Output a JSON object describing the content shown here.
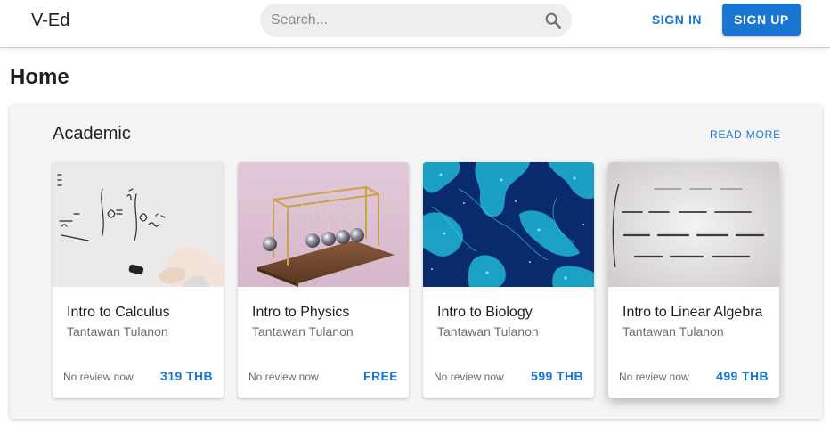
{
  "header": {
    "brand": "V-Ed",
    "search_placeholder": "Search...",
    "signin_label": "SIGN IN",
    "signup_label": "SIGN UP",
    "accent_color": "#1976d2"
  },
  "page": {
    "title": "Home"
  },
  "section": {
    "title": "Academic",
    "read_more": "READ MORE",
    "courses": [
      {
        "title": "Intro to Calculus",
        "author": "Tantawan Tulanon",
        "review": "No review now",
        "price": "319 THB"
      },
      {
        "title": "Intro to Physics",
        "author": "Tantawan Tulanon",
        "review": "No review now",
        "price": "FREE"
      },
      {
        "title": "Intro to Biology",
        "author": "Tantawan Tulanon",
        "review": "No review now",
        "price": "599 THB"
      },
      {
        "title": "Intro to Linear Algebra",
        "author": "Tantawan Tulanon",
        "review": "No review now",
        "price": "499 THB"
      }
    ]
  },
  "icons": {
    "search": "search-icon"
  }
}
